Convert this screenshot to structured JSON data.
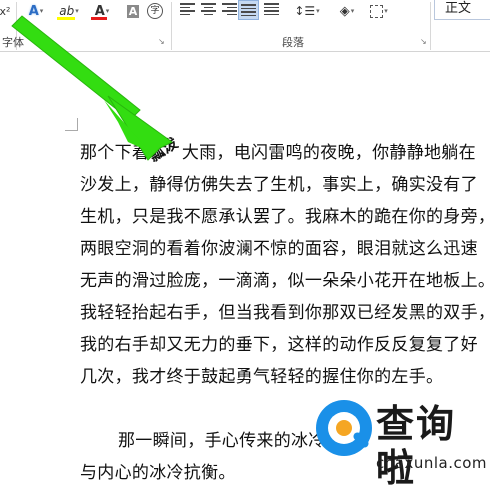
{
  "ribbon": {
    "superscript_label": "x²",
    "text_effects_label": "A",
    "highlight_label": "ab",
    "font_color_label": "A",
    "shading_label": "A",
    "enclose_char_label": "字",
    "font_group_label": "字体",
    "paragraph_group_label": "段落",
    "style_preview": "正文",
    "dropdown_glyph": "▾",
    "dialog_glyph": "↘"
  },
  "document": {
    "lines": [
      {
        "before": "那个下着",
        "rotated": "瓢泼",
        "after": "大雨，电闪雷鸣的夜晚，你静静地躺在"
      },
      {
        "text": "沙发上，静得仿佛失去了生机，事实上，确实没有了"
      },
      {
        "text": "生机，只是我不愿承认罢了。我麻木的跪在你的身旁，"
      },
      {
        "text": "两眼空洞的看着你波澜不惊的面容，眼泪就这么迅速"
      },
      {
        "text": "无声的滑过脸庞，一滴滴，似一朵朵小花开在地板上。"
      },
      {
        "text": "我轻轻抬起右手，但当我看到你那双已经发黑的双手，"
      },
      {
        "text": "我的右手却又无力的垂下，这样的动作反反复复了好"
      },
      {
        "text": "几次，我才终于鼓起勇气轻轻的握住你的左手。"
      },
      {
        "text": "那一瞬间，手心传来的冰冷",
        "indent": true
      },
      {
        "text": "与内心的冰冷抗衡。"
      }
    ]
  },
  "watermark": {
    "title": "查询啦",
    "url": "chaxunla.com"
  },
  "colors": {
    "arrow": "#33dd11",
    "highlight_bar": "#ffff00",
    "font_color_bar": "#e81b1b",
    "watermark_blue": "#1a90e8",
    "watermark_orange": "#f5a623"
  }
}
